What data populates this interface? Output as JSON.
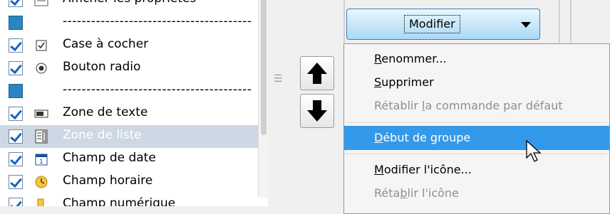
{
  "list": {
    "items": [
      {
        "label": "Afficher les propriétés",
        "checkbox": "checked",
        "icon": "properties-icon",
        "type": "item"
      },
      {
        "label": "----------------------------------------",
        "checkbox": "square",
        "icon": "",
        "type": "separator"
      },
      {
        "label": "Case à cocher",
        "checkbox": "checked",
        "icon": "checkbox-icon",
        "type": "item"
      },
      {
        "label": "Bouton radio",
        "checkbox": "checked",
        "icon": "radio-button-icon",
        "type": "item"
      },
      {
        "label": "----------------------------------------",
        "checkbox": "square",
        "icon": "",
        "type": "separator"
      },
      {
        "label": "Zone de texte",
        "checkbox": "checked",
        "icon": "text-box-icon",
        "type": "item"
      },
      {
        "label": "Zone de liste",
        "checkbox": "checked",
        "icon": "list-box-icon",
        "type": "item",
        "selected": true
      },
      {
        "label": "Champ de date",
        "checkbox": "checked",
        "icon": "date-field-icon",
        "type": "item"
      },
      {
        "label": "Champ horaire",
        "checkbox": "checked",
        "icon": "time-field-icon",
        "type": "item"
      },
      {
        "label": "Champ numérique",
        "checkbox": "checked",
        "icon": "numeric-field-icon",
        "type": "item"
      }
    ]
  },
  "buttons": {
    "move_up_icon": "arrow-up-icon",
    "move_down_icon": "arrow-down-icon"
  },
  "modifier": {
    "label": "Modifier",
    "dropdown_icon": "chevron-down-icon"
  },
  "menu": {
    "items": [
      {
        "pre": "",
        "mnemonic": "R",
        "post": "enommer...",
        "enabled": true
      },
      {
        "pre": "",
        "mnemonic": "S",
        "post": "upprimer",
        "enabled": true
      },
      {
        "pre": "Rétablir ",
        "mnemonic": "l",
        "post": "a commande par défaut",
        "enabled": false
      },
      {
        "pre": "",
        "mnemonic": "D",
        "post": "ébut de groupe",
        "enabled": true,
        "highlighted": true
      },
      {
        "pre": "",
        "mnemonic": "M",
        "post": "odifier l'icône...",
        "enabled": true
      },
      {
        "pre": "Réta",
        "mnemonic": "b",
        "post": "lir l'icône",
        "enabled": false
      }
    ]
  },
  "colors": {
    "selection_row": "#cdd8e4",
    "menu_highlight": "#3399ea",
    "button_gradient_top": "#eaf6fd",
    "button_gradient_bottom": "#a9d9f5",
    "check_color": "#1565c0",
    "disabled_text": "#8f8f8f"
  }
}
